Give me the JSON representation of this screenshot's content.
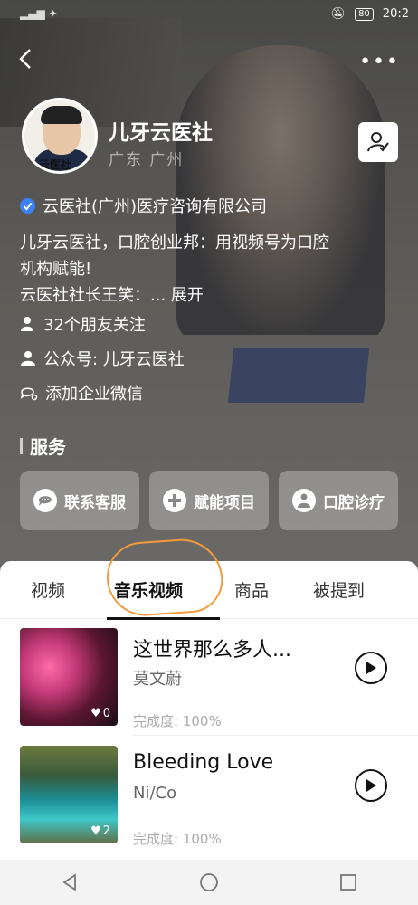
{
  "status": {
    "battery": "80",
    "time": "20:2"
  },
  "profile": {
    "name": "儿牙云医社",
    "location": "广东 广州",
    "avatar_caption": "云医社",
    "verified_org": "云医社(广州)医疗咨询有限公司",
    "bio_line1": "儿牙云医社，口腔创业邦：用视频号为口腔",
    "bio_line2": "机构赋能!",
    "bio_line3": "云医社社长王笑：...",
    "expand": "展开",
    "friends_following": "32个朋友关注",
    "official_account": "公众号: 儿牙云医社",
    "add_wechat": "添加企业微信"
  },
  "services": {
    "title": "服务",
    "items": [
      {
        "label": "联系客服",
        "icon": "chat-icon"
      },
      {
        "label": "赋能项目",
        "icon": "plus-icon"
      },
      {
        "label": "口腔诊疗",
        "icon": "user-icon"
      }
    ]
  },
  "tabs": [
    {
      "label": "视频"
    },
    {
      "label": "音乐视频",
      "active": true
    },
    {
      "label": "商品"
    },
    {
      "label": "被提到"
    }
  ],
  "music": [
    {
      "title": "这世界那么多人...",
      "artist": "莫文蔚",
      "likes": "0",
      "progress": "完成度: 100%"
    },
    {
      "title": "Bleeding Love",
      "artist": "Ni/Co",
      "likes": "2",
      "progress": "完成度: 100%"
    }
  ],
  "colors": {
    "accent_circle": "#f39a3d",
    "verified_blue": "#3b82f6"
  }
}
